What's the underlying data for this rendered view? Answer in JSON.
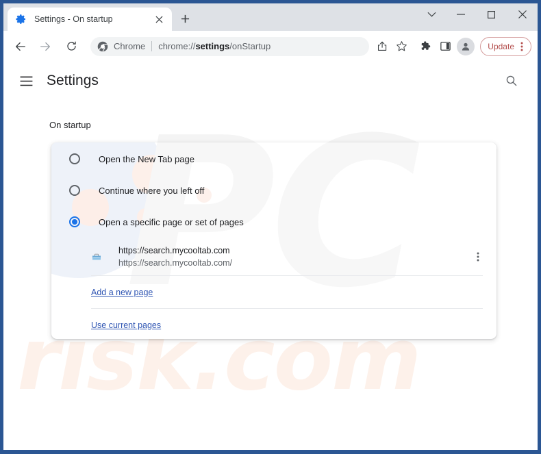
{
  "window": {
    "controls": {
      "chevron_label": "chevron-down",
      "minimize_label": "minimize",
      "maximize_label": "maximize",
      "close_label": "close"
    },
    "frame_color": "#2b5693"
  },
  "tabs": [
    {
      "title": "Settings - On startup",
      "favicon": "gear-icon",
      "active": true,
      "close_label": "×"
    }
  ],
  "new_tab_label": "+",
  "toolbar": {
    "back_label": "back",
    "forward_label": "forward",
    "reload_label": "reload",
    "omnibox": {
      "chrome_label": "Chrome",
      "url_prefix": "chrome://",
      "url_bold": "settings",
      "url_suffix": "/onStartup",
      "full_url": "chrome://settings/onStartup"
    },
    "share_label": "share",
    "bookmark_label": "bookmark",
    "extensions_label": "extensions",
    "side_panel_label": "side panel",
    "profile_label": "profile",
    "update": {
      "label": "Update",
      "color": "#b4504f",
      "border_color": "#d39a9a",
      "menu_label": "more"
    }
  },
  "settings": {
    "menu_label": "Main menu",
    "title": "Settings",
    "search_label": "Search settings",
    "section_title": "On startup",
    "options": [
      {
        "label": "Open the New Tab page",
        "selected": false
      },
      {
        "label": "Continue where you left off",
        "selected": false
      },
      {
        "label": "Open a specific page or set of pages",
        "selected": true
      }
    ],
    "startup_pages": [
      {
        "title": "https://search.mycooltab.com",
        "subtitle": "https://search.mycooltab.com/",
        "favicon": "page-favicon",
        "more_label": "More actions"
      }
    ],
    "add_page_link": "Add a new page",
    "use_current_link": "Use current pages",
    "accent_color": "#1a73e8",
    "link_color": "#3056b3"
  },
  "watermarks": {
    "logo": "PC",
    "domain": "risk.com"
  }
}
